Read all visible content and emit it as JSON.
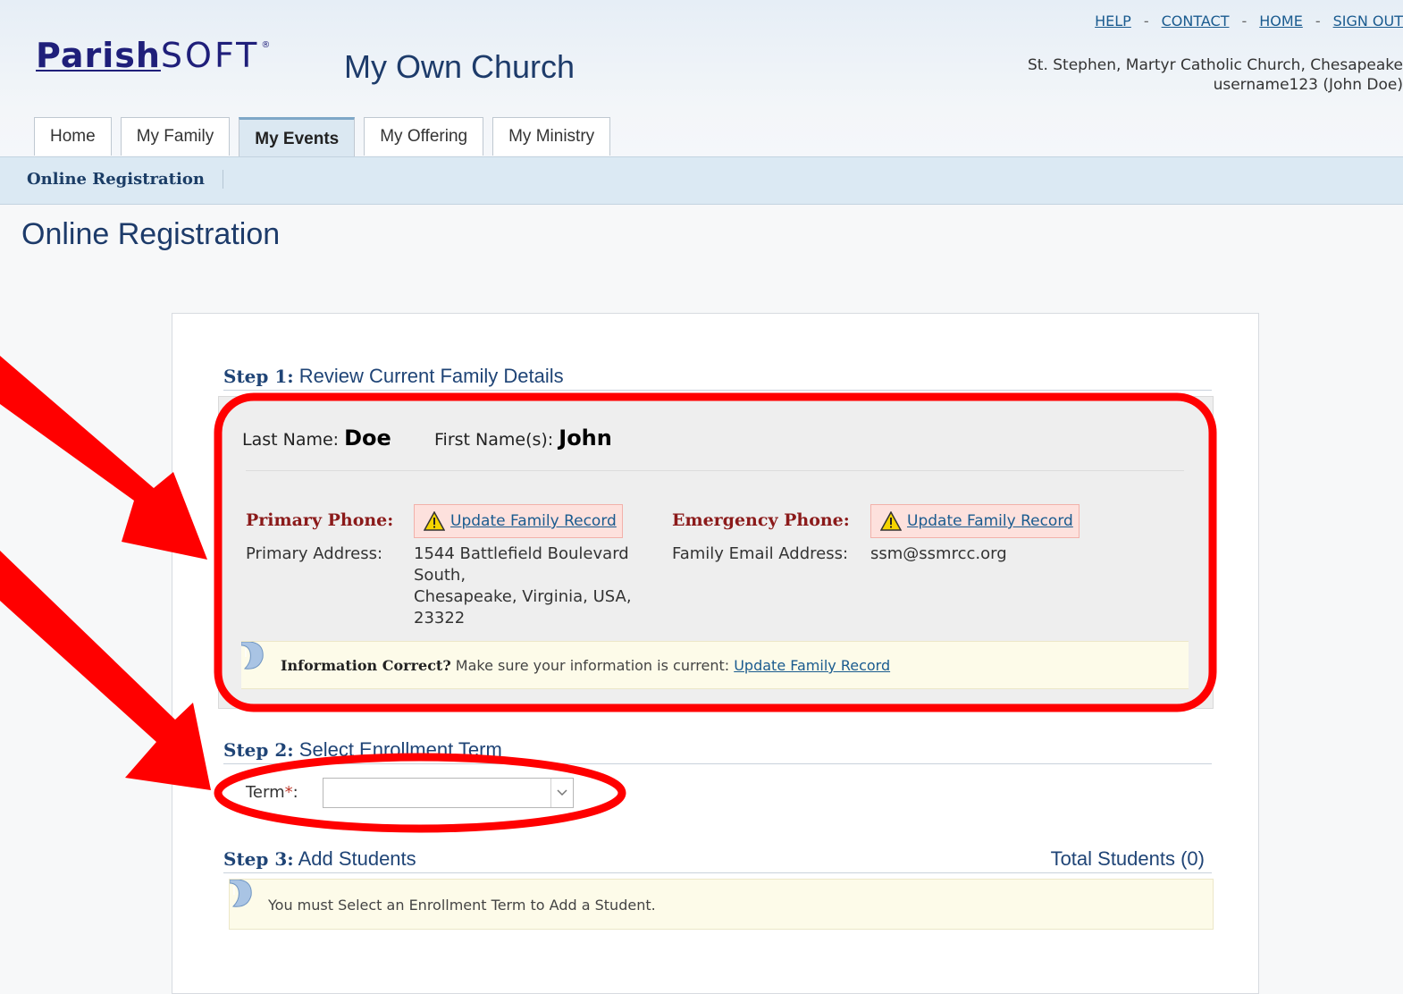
{
  "header": {
    "logo_part1": "Parish",
    "logo_part2": "SOFT",
    "logo_reg": "®",
    "church_title": "My Own Church",
    "top_links": [
      "HELP",
      "CONTACT",
      "HOME",
      "SIGN OUT"
    ],
    "separator": "-",
    "church_name": "St. Stephen, Martyr Catholic Church, Chesapeake",
    "user": "username123 (John Doe)"
  },
  "tabs": [
    {
      "label": "Home",
      "active": false
    },
    {
      "label": "My Family",
      "active": false
    },
    {
      "label": "My Events",
      "active": true
    },
    {
      "label": "My Offering",
      "active": false
    },
    {
      "label": "My Ministry",
      "active": false
    }
  ],
  "subnav": {
    "item": "Online Registration"
  },
  "page_title": "Online Registration",
  "step1": {
    "num": "Step 1:",
    "title": "Review Current Family Details",
    "last_name_label": "Last Name:",
    "last_name": "Doe",
    "first_name_label": "First Name(s):",
    "first_name": "John",
    "primary_phone_label": "Primary Phone:",
    "emergency_phone_label": "Emergency Phone:",
    "update_link": "Update Family Record",
    "primary_address_label": "Primary Address:",
    "address_line1": "1544 Battlefield Boulevard",
    "address_line2": "South,",
    "address_line3": "Chesapeake, Virginia, USA,",
    "address_line4": "23322",
    "email_label": "Family Email Address:",
    "email": "ssm@ssmrcc.org",
    "info_bold": "Information Correct?",
    "info_text": " Make sure your information is current: ",
    "info_link": "Update Family Record"
  },
  "step2": {
    "num": "Step 2:",
    "title": "Select Enrollment Term",
    "term_label": "Term",
    "required_mark": "*",
    "colon": ":",
    "term_value": ""
  },
  "step3": {
    "num": "Step 3:",
    "title": "Add Students",
    "total_label": "Total Students (0)",
    "message": "You must Select an Enrollment Term to Add a Student."
  },
  "colors": {
    "annotation": "#ff0000",
    "link": "#1a5b8f",
    "heading": "#1f4476",
    "required_label": "#8b1a1a"
  }
}
